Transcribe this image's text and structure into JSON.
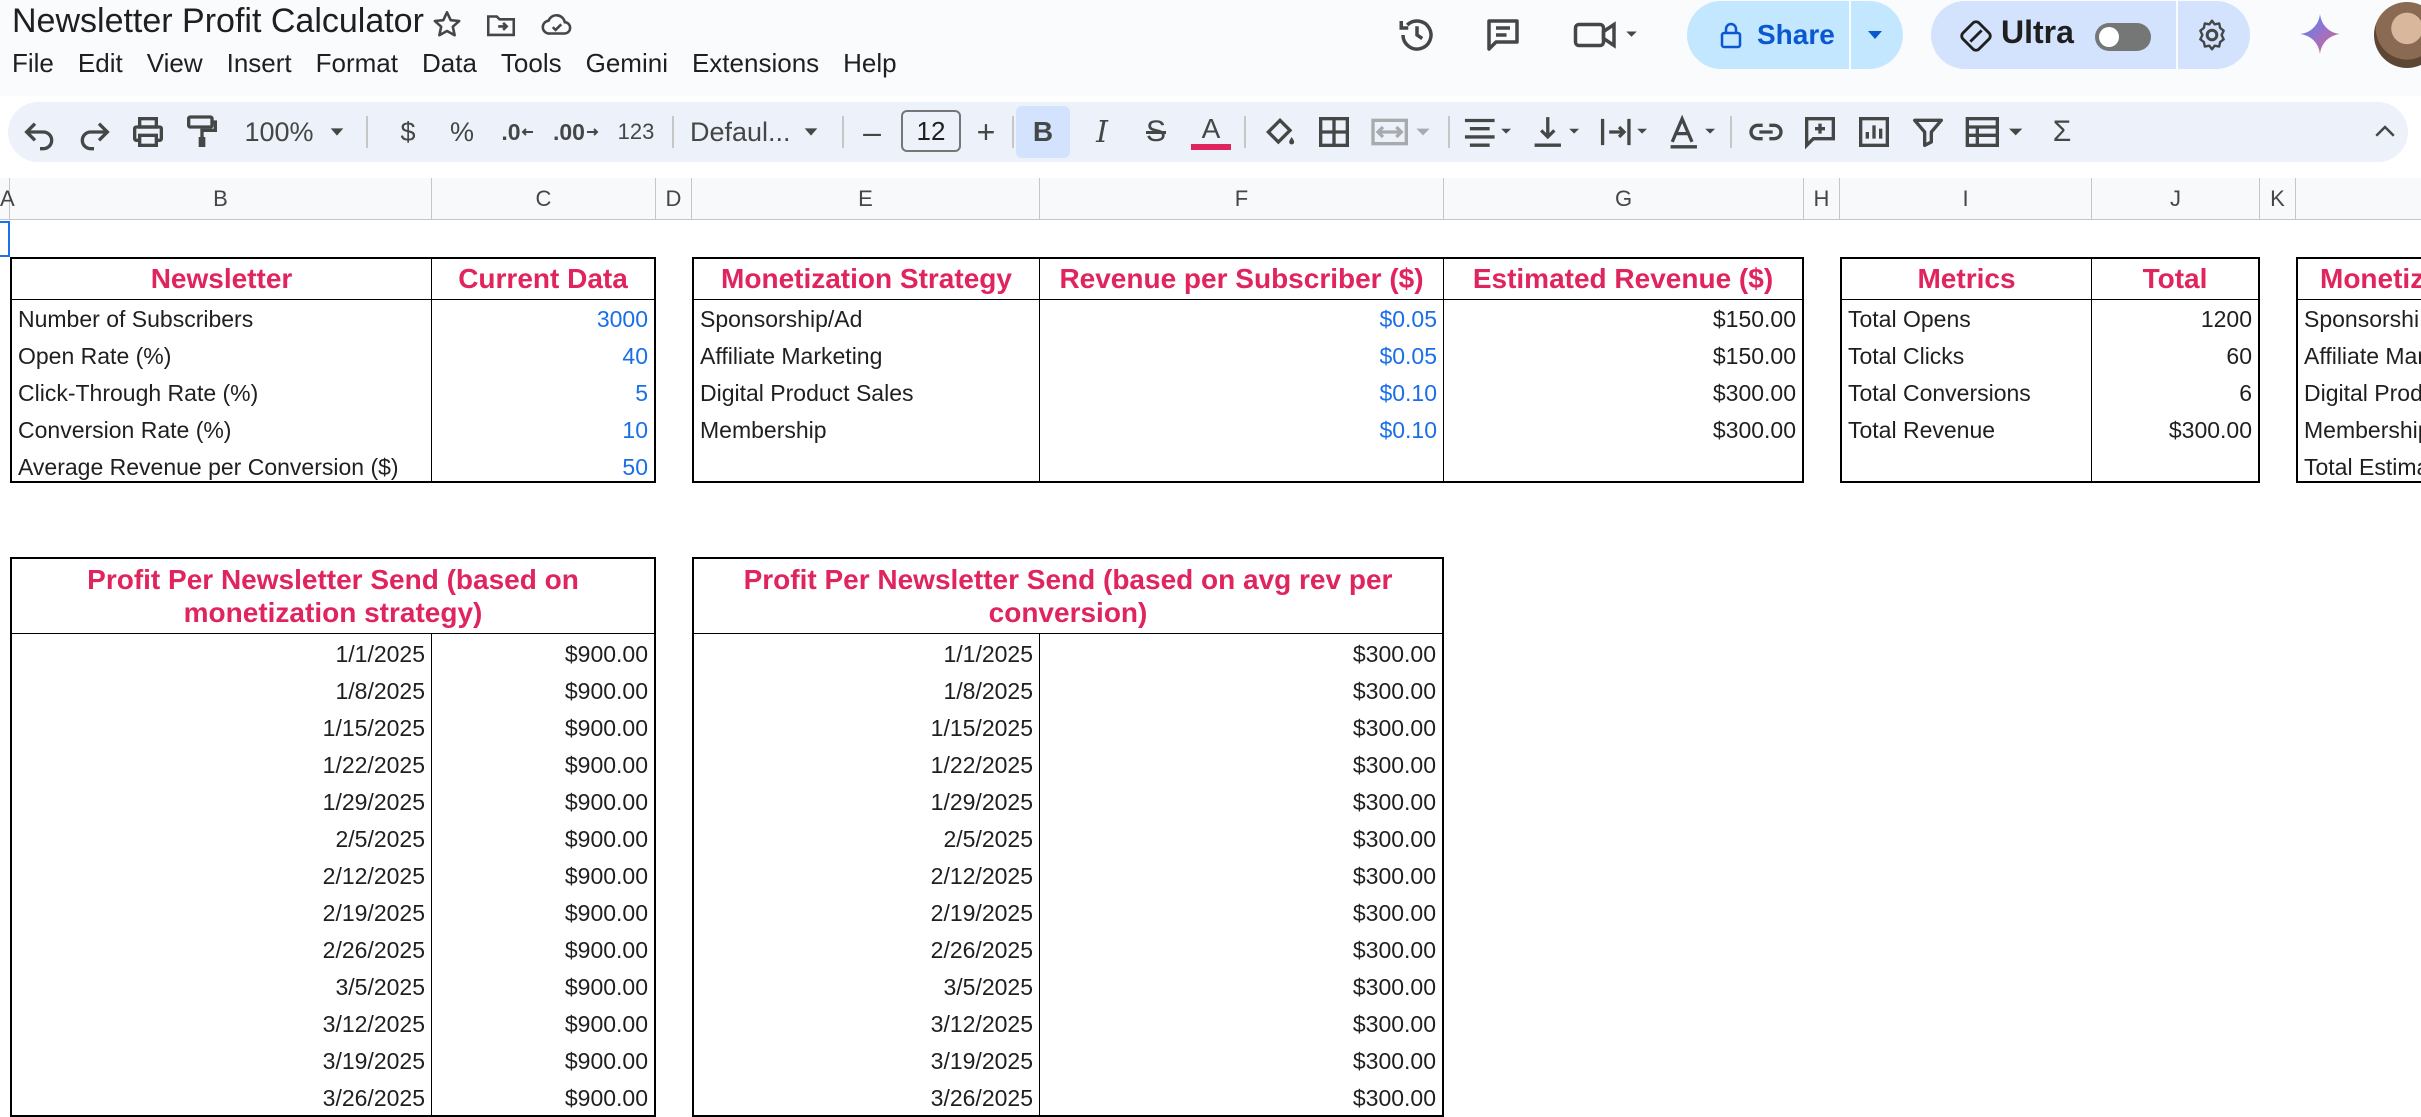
{
  "app": {
    "title": "Newsletter Profit Calculator",
    "menu": [
      "File",
      "Edit",
      "View",
      "Insert",
      "Format",
      "Data",
      "Tools",
      "Gemini",
      "Extensions",
      "Help"
    ],
    "share_label": "Share",
    "ultra_label": "Ultra",
    "icons": {
      "star": "star-icon",
      "move": "move-to-folder-icon",
      "cloud": "cloud-saved-icon",
      "history": "version-history-icon",
      "comments": "comments-icon",
      "meet": "meet-video-icon",
      "lock": "lock-icon",
      "ultra": "ultra-icon",
      "settings": "gear-icon",
      "gemini": "gemini-spark-icon"
    },
    "colors": {
      "accent": "#e0245e",
      "input_blue": "#1a6fe8",
      "share_bg": "#c2e7ff",
      "toolbar_bg": "#edf2fa"
    }
  },
  "toolbar": {
    "zoom": "100%",
    "currency": "$",
    "percent": "%",
    "dec_less": ".0",
    "dec_more": ".00",
    "number_format": "123",
    "font": "Defaul...",
    "font_size": "12",
    "minus": "–",
    "plus": "+",
    "bold": "B",
    "italic": "I",
    "strike": "S",
    "text_color": "A",
    "sigma": "Σ"
  },
  "columns": [
    "A",
    "B",
    "C",
    "D",
    "E",
    "F",
    "G",
    "H",
    "I",
    "J",
    "K"
  ],
  "table1": {
    "headers": [
      "Newsletter",
      "Current Data"
    ],
    "rows": [
      {
        "label": "Number of Subscribers",
        "value": "3000"
      },
      {
        "label": "Open Rate (%)",
        "value": "40"
      },
      {
        "label": "Click-Through Rate (%)",
        "value": "5"
      },
      {
        "label": "Conversion Rate (%)",
        "value": "10"
      },
      {
        "label": "Average Revenue per Conversion ($)",
        "value": "50"
      }
    ]
  },
  "table2": {
    "headers": [
      "Monetization Strategy",
      "Revenue per Subscriber ($)",
      "Estimated Revenue ($)"
    ],
    "rows": [
      {
        "strategy": "Sponsorship/Ad",
        "rps": "$0.05",
        "est": "$150.00"
      },
      {
        "strategy": "Affiliate Marketing",
        "rps": "$0.05",
        "est": "$150.00"
      },
      {
        "strategy": "Digital Product Sales",
        "rps": "$0.10",
        "est": "$300.00"
      },
      {
        "strategy": "Membership",
        "rps": "$0.10",
        "est": "$300.00"
      }
    ]
  },
  "table3": {
    "headers": [
      "Metrics",
      "Total"
    ],
    "rows": [
      {
        "metric": "Total Opens",
        "total": "1200"
      },
      {
        "metric": "Total Clicks",
        "total": "60"
      },
      {
        "metric": "Total Conversions",
        "total": "6"
      },
      {
        "metric": "Total Revenue",
        "total": "$300.00"
      }
    ]
  },
  "table4": {
    "header": "Monetiz",
    "rows": [
      "Sponsorshi",
      "Affiliate Mar",
      "Digital Prod",
      "Membership",
      "Total Estima"
    ]
  },
  "table5": {
    "header_line1": "Profit Per Newsletter Send (based on",
    "header_line2": "monetization strategy)",
    "rows": [
      {
        "date": "1/1/2025",
        "amount": "$900.00"
      },
      {
        "date": "1/8/2025",
        "amount": "$900.00"
      },
      {
        "date": "1/15/2025",
        "amount": "$900.00"
      },
      {
        "date": "1/22/2025",
        "amount": "$900.00"
      },
      {
        "date": "1/29/2025",
        "amount": "$900.00"
      },
      {
        "date": "2/5/2025",
        "amount": "$900.00"
      },
      {
        "date": "2/12/2025",
        "amount": "$900.00"
      },
      {
        "date": "2/19/2025",
        "amount": "$900.00"
      },
      {
        "date": "2/26/2025",
        "amount": "$900.00"
      },
      {
        "date": "3/5/2025",
        "amount": "$900.00"
      },
      {
        "date": "3/12/2025",
        "amount": "$900.00"
      },
      {
        "date": "3/19/2025",
        "amount": "$900.00"
      },
      {
        "date": "3/26/2025",
        "amount": "$900.00"
      }
    ]
  },
  "table6": {
    "header_line1": "Profit Per Newsletter Send (based on avg rev per",
    "header_line2": "conversion)",
    "rows": [
      {
        "date": "1/1/2025",
        "amount": "$300.00"
      },
      {
        "date": "1/8/2025",
        "amount": "$300.00"
      },
      {
        "date": "1/15/2025",
        "amount": "$300.00"
      },
      {
        "date": "1/22/2025",
        "amount": "$300.00"
      },
      {
        "date": "1/29/2025",
        "amount": "$300.00"
      },
      {
        "date": "2/5/2025",
        "amount": "$300.00"
      },
      {
        "date": "2/12/2025",
        "amount": "$300.00"
      },
      {
        "date": "2/19/2025",
        "amount": "$300.00"
      },
      {
        "date": "2/26/2025",
        "amount": "$300.00"
      },
      {
        "date": "3/5/2025",
        "amount": "$300.00"
      },
      {
        "date": "3/12/2025",
        "amount": "$300.00"
      },
      {
        "date": "3/19/2025",
        "amount": "$300.00"
      },
      {
        "date": "3/26/2025",
        "amount": "$300.00"
      }
    ]
  }
}
